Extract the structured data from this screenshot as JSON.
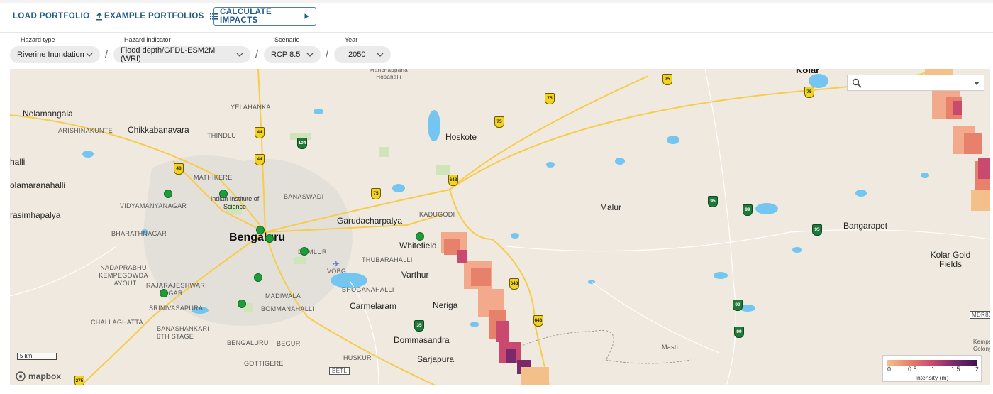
{
  "toolbar": {
    "load_portfolio": "LOAD PORTFOLIO",
    "example_portfolios": "EXAMPLE PORTFOLIOS",
    "calculate_impacts": "CALCULATE IMPACTS"
  },
  "selectors": {
    "hazard_type": {
      "label": "Hazard type",
      "value": "Riverine Inundation"
    },
    "hazard_indicator": {
      "label": "Hazard indicator",
      "value": "Flood depth/GFDL-ESM2M (WRI)"
    },
    "scenario": {
      "label": "Scenario",
      "value": "RCP 8.5"
    },
    "year": {
      "label": "Year",
      "value": "2050"
    },
    "separator": "/"
  },
  "map": {
    "labels": {
      "nelamangala": "Nelamangala",
      "arishinakunte": "ARISHINAKUNTE",
      "chikkabanavara": "Chikkabanavara",
      "yelahanka": "YELAHANKA",
      "thindlu": "THINDLU",
      "mathikere": "MATHIKERE",
      "vidyamanyanagar": "VIDYAMANYANAGAR",
      "iisc": "Indian Institute of Science",
      "banaswadi": "BANASWADI",
      "bharathnagar": "BHARATHNAGAR",
      "bengaluru": "Bengaluru",
      "domlur": "DOMLUR",
      "nadaprabhu": "NADAPRABHU KEMPEGOWDA LAYOUT",
      "rajarajeshwari": "RAJARAJESHWARI NAGAR",
      "srinivasapura": "SRINIVASAPURA",
      "challaghatta": "CHALLAGHATTA",
      "banashankari": "BANASHANKARI 6TH STAGE",
      "madiwala": "MADIWALA",
      "bommanahalli": "BOMMANAHALLI",
      "bengaluru_south": "BENGALURU",
      "begur": "BEGUR",
      "gottigere": "GOTTIGERE",
      "huskur": "HUSKUR",
      "vobg": "VOBG",
      "garudacharpalya": "Garudacharpalya",
      "kadugodi": "KADUGODI",
      "whitefield": "Whitefield",
      "thubarahalli": "THUBARAHALLI",
      "varthur": "Varthur",
      "bhoganahalli": "BHOGANAHALLI",
      "carmelaram": "Carmelaram",
      "neriga": "Neriga",
      "dommasandra": "Dommasandra",
      "sarjapura": "Sarjapura",
      "hoskote": "Hoskote",
      "manchappana": "Manchappana Hosahalli",
      "malur": "Malur",
      "bangarapet": "Bangarapet",
      "kolar": "Kolar",
      "kolar_gold": "Kolar Gold Fields",
      "masti": "Masti",
      "mdr83": "MDR83",
      "kempapura": "Kempapura Colony",
      "halli": "halli",
      "olamaranahalli": "olamaranahalli",
      "rasimhapalya": "rasimhapalya",
      "betl": "BETL"
    },
    "shields": [
      "44",
      "44",
      "48",
      "104",
      "75",
      "75",
      "75",
      "75",
      "75",
      "648",
      "648",
      "648",
      "95",
      "95",
      "99",
      "99",
      "99",
      "35",
      "275"
    ],
    "search": {
      "placeholder": ""
    },
    "scale": "5 km",
    "attribution": "mapbox",
    "legend": {
      "ticks": [
        "0",
        "0.5",
        "1",
        "1.5",
        "2"
      ],
      "unit": "Intensity (m)"
    },
    "colors": {
      "flood_low": "#f4c08a",
      "flood_mid": "#e8816c",
      "flood_high": "#c94a6e",
      "flood_max": "#3b1452",
      "poi": "#1e9c3a",
      "water": "#74c6f0"
    }
  }
}
